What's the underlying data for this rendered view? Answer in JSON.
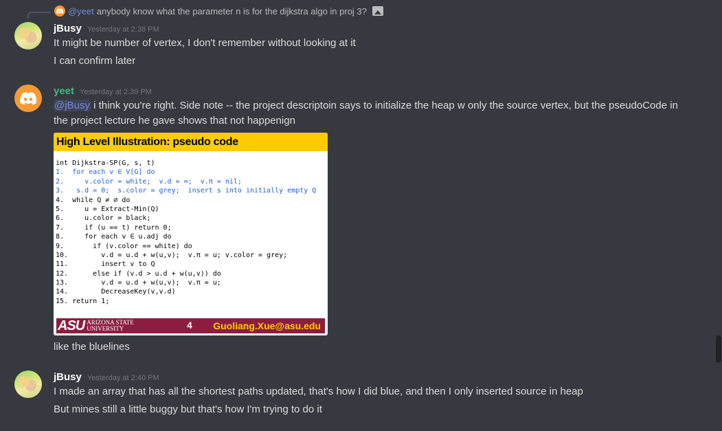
{
  "reply": {
    "mention": "@yeet",
    "text": "anybody know what the parameter n is for the dijkstra algo in proj 3?"
  },
  "messages": [
    {
      "username": "jBusy",
      "username_color": "#ffffff",
      "timestamp": "Yesterday at 2:38 PM",
      "lines": [
        "It might be number of vertex, I don't remember without looking at it",
        "I can confirm later"
      ]
    },
    {
      "username": "yeet",
      "username_color": "#43b581",
      "timestamp": "Yesterday at 2:39 PM",
      "mention": "@jBusy",
      "lines": [
        " i think you're right. Side note -- the project descriptoin says to initialize the heap w only the source vertex, but the pseudoCode in",
        "the project lecture he gave shows that not happenign"
      ],
      "after_image": "like the bluelines"
    },
    {
      "username": "jBusy",
      "username_color": "#ffffff",
      "timestamp": "Yesterday at 2:40 PM",
      "lines": [
        "I made an array that has all the shortest paths updated, that's how I did blue, and then I only inserted source in heap",
        "But mines still a little buggy but that's how I'm trying to do it"
      ]
    }
  ],
  "slide": {
    "title": "High Level Illustration: pseudo code",
    "code": [
      {
        "text": "int Dijkstra-SP(G, s, t)",
        "blue": false
      },
      {
        "text": "1.  for each v ∈ V[G] do",
        "blue": true
      },
      {
        "text": "2.     v.color = white;  v.d = ∞;  v.π = nil;",
        "blue": true
      },
      {
        "text": "3.   s.d = 0;  s.color = grey;  insert s into initially empty Q",
        "blue": true
      },
      {
        "text": "4.  while Q ≠ ∅ do",
        "blue": false
      },
      {
        "text": "5.     u = Extract-Min(Q)",
        "blue": false
      },
      {
        "text": "6.     u.color = black;",
        "blue": false
      },
      {
        "text": "7.     if (u == t) return 0;",
        "blue": false
      },
      {
        "text": "8.     for each v ∈ u.adj do",
        "blue": false
      },
      {
        "text": "9.       if (v.color == white) do",
        "blue": false
      },
      {
        "text": "10.        v.d = u.d + w(u,v);  v.π = u; v.color = grey;",
        "blue": false
      },
      {
        "text": "11.        insert v to Q",
        "blue": false
      },
      {
        "text": "12.      else if (v.d > u.d + w(u,v)) do",
        "blue": false
      },
      {
        "text": "13.        v.d = u.d + w(u,v);  v.π = u;",
        "blue": false
      },
      {
        "text": "14.        DecreaseKey(v,v.d)",
        "blue": false
      },
      {
        "text": "15. return 1;",
        "blue": false
      }
    ],
    "footer": {
      "logo_mark": "ASU",
      "logo_line1": "ARIZONA STATE",
      "logo_line2": "UNIVERSITY",
      "page": "4",
      "email": "Guoliang.Xue@asu.edu"
    }
  },
  "colors": {
    "background": "#36393f",
    "mention": "#7289da",
    "timestamp": "#72767d",
    "slide_header": "#ffcc00",
    "slide_footer": "#8c1d40"
  }
}
